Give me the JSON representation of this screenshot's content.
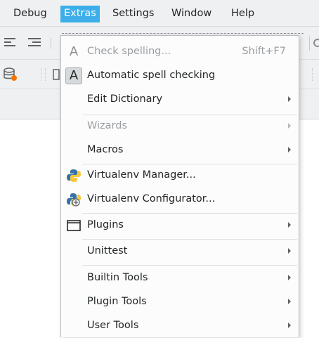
{
  "menubar": {
    "items": [
      {
        "label": "Debug",
        "active": false
      },
      {
        "label": "Extras",
        "active": true
      },
      {
        "label": "Settings",
        "active": false
      },
      {
        "label": "Window",
        "active": false
      },
      {
        "label": "Help",
        "active": false
      }
    ]
  },
  "extras_menu": {
    "items": [
      {
        "label": "Check spelling...",
        "shortcut": "Shift+F7",
        "icon": "spellcheck-icon",
        "disabled": true
      },
      {
        "label": "Automatic spell checking",
        "icon": "spellcheck-icon",
        "checked": true
      },
      {
        "label": "Edit Dictionary",
        "submenu": true
      },
      {
        "label": "Wizards",
        "submenu": true,
        "disabled": true
      },
      {
        "label": "Macros",
        "submenu": true
      },
      {
        "label": "Virtualenv Manager...",
        "icon": "python-icon"
      },
      {
        "label": "Virtualenv Configurator...",
        "icon": "python-config-icon"
      },
      {
        "label": "Plugins",
        "submenu": true,
        "icon": "plugins-window-icon"
      },
      {
        "label": "Unittest",
        "submenu": true
      },
      {
        "label": "Builtin Tools",
        "submenu": true
      },
      {
        "label": "Plugin Tools",
        "submenu": true
      },
      {
        "label": "User Tools",
        "submenu": true
      }
    ]
  },
  "colors": {
    "accent": "#3daee9",
    "menu_bg": "#fcfcfc",
    "toolbar_bg": "#eff0f1"
  }
}
